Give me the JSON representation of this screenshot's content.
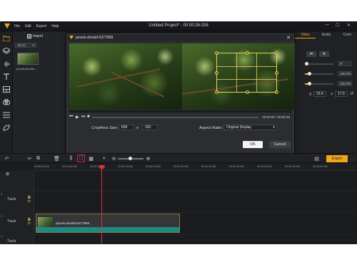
{
  "titlebar": {
    "menu": [
      "File",
      "Edit",
      "Export",
      "Help"
    ],
    "title": "Untitled Project* - 00:00:26.026",
    "minimize": "—",
    "maximize": "☐",
    "close": "✕"
  },
  "media_panel": {
    "import_label": "Import",
    "filter_value": "All (1)",
    "media_item_label": "pexels-donald..."
  },
  "properties_panel": {
    "tabs": [
      "Video",
      "Audio",
      "Color"
    ],
    "active_tab": "Video",
    "values": [
      "0°",
      "100.0%",
      "100.0%"
    ],
    "x_label": "X",
    "x_value": "23.6",
    "y_label": "Y",
    "y_value": "17.5"
  },
  "crop_dialog": {
    "title": "pexels-donald-5377869",
    "close": "✕",
    "timecode": "00:00:00 / 00:00:26",
    "crop_area_label": "CropArea Size:",
    "crop_width": "699",
    "crop_x": "x",
    "crop_height": "393",
    "aspect_ratio_label": "Aspect Ratio:",
    "aspect_ratio_value": "Original Display",
    "ok_label": "OK",
    "cancel_label": "Cancel"
  },
  "toolbar": {
    "export_label": "Export"
  },
  "timeline": {
    "ruler_ticks": [
      "00:00:00.000",
      "00:00:05.000",
      "00:00:10.000",
      "00:00:15.000",
      "00:00:20.000",
      "00:00:25.000",
      "00:00:30.000",
      "00:00:35.000",
      "00:00:40.000",
      "00:00:45.000",
      "00:00:50.000"
    ],
    "track_numbers": [
      "3",
      "2",
      "1"
    ],
    "track_label": "Track",
    "clip_name": "pexels-donald-5377869"
  },
  "colors": {
    "accent": "#f0a81a",
    "playhead": "#e23030",
    "audio_wave": "#1f8a84",
    "highlight_box": "#e02424"
  }
}
